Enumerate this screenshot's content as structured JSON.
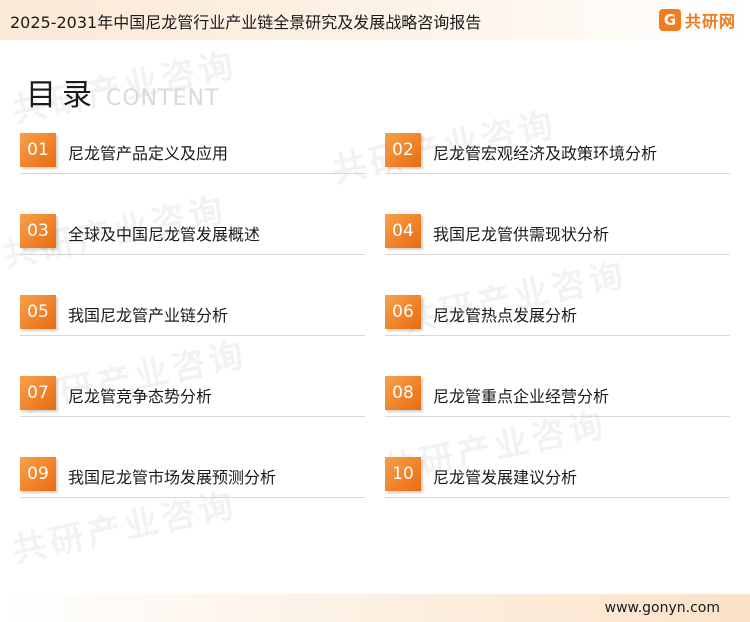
{
  "header": {
    "title": "2025-2031年中国尼龙管行业产业链全景研究及发展战略咨询报告",
    "brand_icon": "G",
    "brand_name": "共研网"
  },
  "watermark": {
    "text": "共研产业咨询",
    "url_text": "w w w . g o n y n . c o m"
  },
  "toc": {
    "title": "目录",
    "subtitle": "CONTENT",
    "items": [
      {
        "num": "01",
        "label": "尼龙管产品定义及应用"
      },
      {
        "num": "02",
        "label": "尼龙管宏观经济及政策环境分析"
      },
      {
        "num": "03",
        "label": "全球及中国尼龙管发展概述"
      },
      {
        "num": "04",
        "label": "我国尼龙管供需现状分析"
      },
      {
        "num": "05",
        "label": "我国尼龙管产业链分析"
      },
      {
        "num": "06",
        "label": "尼龙管热点发展分析"
      },
      {
        "num": "07",
        "label": "尼龙管竞争态势分析"
      },
      {
        "num": "08",
        "label": "尼龙管重点企业经营分析"
      },
      {
        "num": "09",
        "label": "我国尼龙管市场发展预测分析"
      },
      {
        "num": "10",
        "label": "尼龙管发展建议分析"
      }
    ]
  },
  "footer": {
    "url": "www.gonyn.com"
  },
  "colors": {
    "accent": "#ea6b10",
    "accent_light": "#f7a14c",
    "header_bg": "#fbe9d6"
  }
}
